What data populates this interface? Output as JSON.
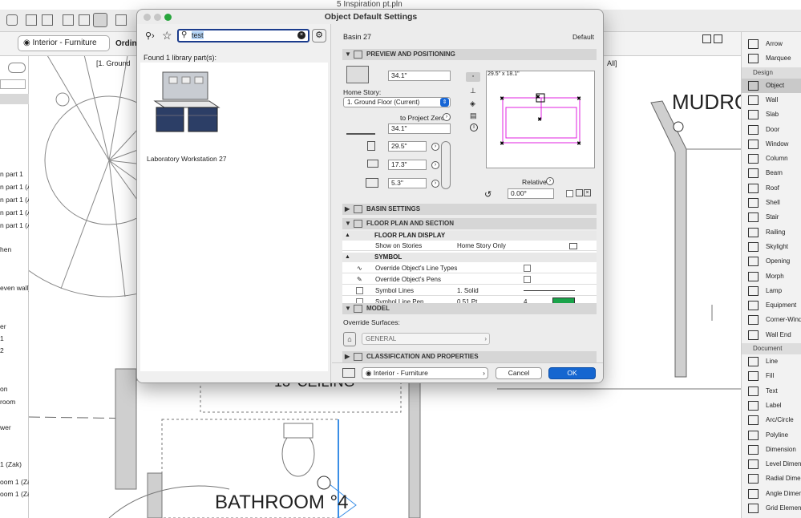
{
  "app": {
    "window_title": "5 Inspiration pt.pln",
    "layer_combo": "Interior - Furniture",
    "ordinate_label": "Ordinat",
    "view_label": "[1. Ground",
    "view_label_right": "All]",
    "plan_labels": {
      "mudroom": "MUDRO",
      "bathroom": "BATHROOM °4",
      "ceiling": "13' CEILING"
    },
    "left_panel_items": [
      "n part 1",
      "n part 1 (Au",
      "n part 1 (Au",
      "n part 1 (Au",
      "n part 1 (Au",
      "hen",
      "even wall)",
      "er",
      "1",
      "2",
      "on",
      "room",
      "wer",
      "1 (Zak)",
      "oom 1 (Zak",
      "oom 1 (Zak"
    ]
  },
  "toolbox": {
    "items_top": [
      "Arrow",
      "Marquee"
    ],
    "design_header": "Design",
    "design_items": [
      "Object",
      "Wall",
      "Slab",
      "Door",
      "Window",
      "Column",
      "Beam",
      "Roof",
      "Shell",
      "Stair",
      "Railing",
      "Skylight",
      "Opening",
      "Morph",
      "Lamp",
      "Equipment",
      "Corner-Windo",
      "Wall End"
    ],
    "document_header": "Document",
    "document_items": [
      "Line",
      "Fill",
      "Text",
      "Label",
      "Arc/Circle",
      "Polyline",
      "Dimension",
      "Level Dimens",
      "Radial Dimen",
      "Angle Dimens",
      "Grid Element"
    ],
    "selected": "Object"
  },
  "dialog": {
    "title": "Object Default Settings",
    "search": {
      "value": "test"
    },
    "found_text": "Found 1 library part(s):",
    "result_label": "Laboratory Workstation 27",
    "object_name": "Basin 27",
    "default_label": "Default",
    "sections": {
      "preview": "PREVIEW AND POSITIONING",
      "basin": "BASIN SETTINGS",
      "floor_plan": "FLOOR PLAN AND SECTION",
      "model": "MODEL",
      "classification": "CLASSIFICATION AND PROPERTIES"
    },
    "elevation_value": "34.1\"",
    "home_story_label": "Home Story:",
    "home_story_value": "1. Ground Floor (Current)",
    "to_project_zero": "to Project Zero",
    "project_zero_value": "34.1\"",
    "dim_x": "29.5\"",
    "dim_y": "17.3\"",
    "dim_z": "5.3\"",
    "preview_dims": "29.5\" x 18.1\"",
    "relative_label": "Relative",
    "rotation_value": "0.00°",
    "floor_plan_display": "FLOOR PLAN DISPLAY",
    "show_on_stories_label": "Show on Stories",
    "show_on_stories_value": "Home Story Only",
    "symbol_header": "SYMBOL",
    "override_line_types": "Override Object's Line Types",
    "override_pens": "Override Object's Pens",
    "symbol_lines_label": "Symbol Lines",
    "symbol_lines_value": "1. Solid",
    "symbol_line_pen_label": "Symbol Line Pen",
    "symbol_line_pen_value": "0.51 Pt",
    "symbol_line_pen_num": "4",
    "override_surfaces_label": "Override Surfaces:",
    "surface_value": "GENERAL",
    "layer_value": "Interior - Furniture",
    "cancel_label": "Cancel",
    "ok_label": "OK"
  },
  "colors": {
    "accent": "#0a64d2",
    "highlight_pink": "#e020e0",
    "ok_button": "#1566d0"
  }
}
